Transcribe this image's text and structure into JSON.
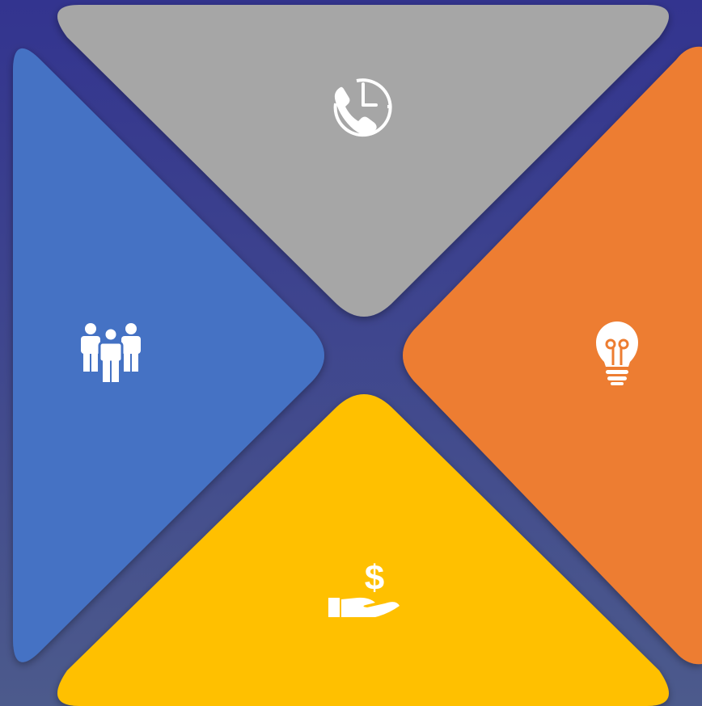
{
  "background": {
    "top_color": "#33348f",
    "bottom_color": "#4c5a8c"
  },
  "segments": [
    {
      "id": "top",
      "color": "#a6a6a6",
      "icon": "phone-clock-icon"
    },
    {
      "id": "left",
      "color": "#4472c4",
      "icon": "team-people-icon"
    },
    {
      "id": "right",
      "color": "#ed7d31",
      "icon": "lightbulb-icon"
    },
    {
      "id": "bottom",
      "color": "#ffc000",
      "icon": "money-hand-icon"
    }
  ],
  "icon_color": "#ffffff"
}
